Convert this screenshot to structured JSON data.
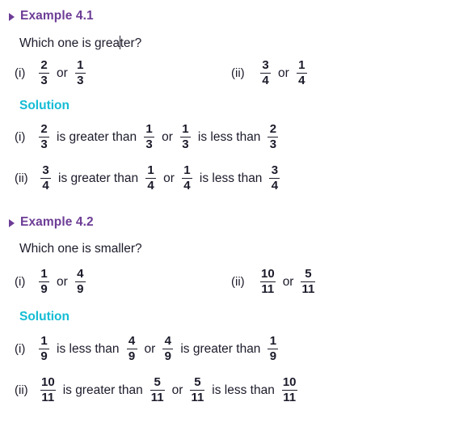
{
  "page": {
    "background_color": "#ffffff",
    "text_color": "#1b1b2b",
    "heading_color": "#6d3d96",
    "solution_color": "#14bcd4",
    "caret_visible": true
  },
  "examples": [
    {
      "bullet_icon": "triangle-right-icon",
      "title": "Example 4.1",
      "question_before_caret": "Which one is grea",
      "question_after_caret": "ter?",
      "question_full": "Which one is greater?",
      "problems": [
        {
          "label": "(i)",
          "first": {
            "num": "2",
            "den": "3"
          },
          "connector": "or",
          "second": {
            "num": "1",
            "den": "3"
          }
        },
        {
          "label": "(ii)",
          "first": {
            "num": "3",
            "den": "4"
          },
          "connector": "or",
          "second": {
            "num": "1",
            "den": "4"
          }
        }
      ],
      "solution_label": "Solution",
      "solutions": [
        {
          "label": "(i)",
          "f1": {
            "num": "2",
            "den": "3"
          },
          "phrase1": "is greater than",
          "f2": {
            "num": "1",
            "den": "3"
          },
          "connector": "or",
          "f3": {
            "num": "1",
            "den": "3"
          },
          "phrase2": "is less than",
          "f4": {
            "num": "2",
            "den": "3"
          }
        },
        {
          "label": "(ii)",
          "f1": {
            "num": "3",
            "den": "4"
          },
          "phrase1": "is greater than",
          "f2": {
            "num": "1",
            "den": "4"
          },
          "connector": "or",
          "f3": {
            "num": "1",
            "den": "4"
          },
          "phrase2": "is less than",
          "f4": {
            "num": "3",
            "den": "4"
          }
        }
      ]
    },
    {
      "bullet_icon": "triangle-right-icon",
      "title": "Example 4.2",
      "question_full": "Which one is smaller?",
      "problems": [
        {
          "label": "(i)",
          "first": {
            "num": "1",
            "den": "9"
          },
          "connector": "or",
          "second": {
            "num": "4",
            "den": "9"
          }
        },
        {
          "label": "(ii)",
          "first": {
            "num": "10",
            "den": "11"
          },
          "connector": "or",
          "second": {
            "num": "5",
            "den": "11"
          }
        }
      ],
      "solution_label": "Solution",
      "solutions": [
        {
          "label": "(i)",
          "f1": {
            "num": "1",
            "den": "9"
          },
          "phrase1": "is less than",
          "f2": {
            "num": "4",
            "den": "9"
          },
          "connector": "or",
          "f3": {
            "num": "4",
            "den": "9"
          },
          "phrase2": "is greater than",
          "f4": {
            "num": "1",
            "den": "9"
          }
        },
        {
          "label": "(ii)",
          "f1": {
            "num": "10",
            "den": "11"
          },
          "phrase1": "is greater than",
          "f2": {
            "num": "5",
            "den": "11"
          },
          "connector": "or",
          "f3": {
            "num": "5",
            "den": "11"
          },
          "phrase2": "is less than",
          "f4": {
            "num": "10",
            "den": "11"
          }
        }
      ]
    }
  ]
}
